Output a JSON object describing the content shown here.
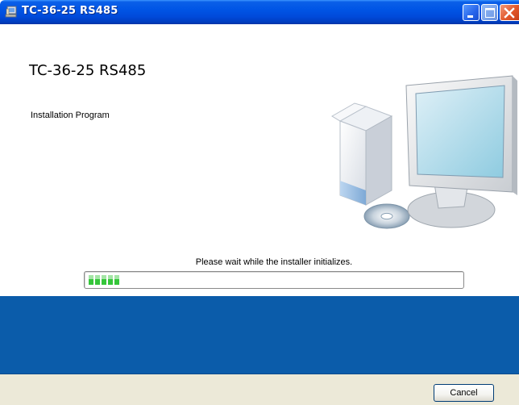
{
  "window": {
    "title": "TC-36-25 RS485"
  },
  "content": {
    "heading": "TC-36-25 RS485",
    "subtitle": "Installation Program",
    "status_text": "Please wait while the installer initializes."
  },
  "progress": {
    "fraction": 0.08
  },
  "buttons": {
    "cancel_label": "Cancel"
  },
  "colors": {
    "titlebar": "#0055e5",
    "band": "#0b5caa",
    "footer": "#ece9d8",
    "progress_fill": "#35c63a"
  },
  "icons": {
    "app": "computer-icon",
    "minimize": "minimize-icon",
    "maximize": "maximize-icon",
    "close": "close-icon",
    "hero": "computer-setup-illustration"
  }
}
